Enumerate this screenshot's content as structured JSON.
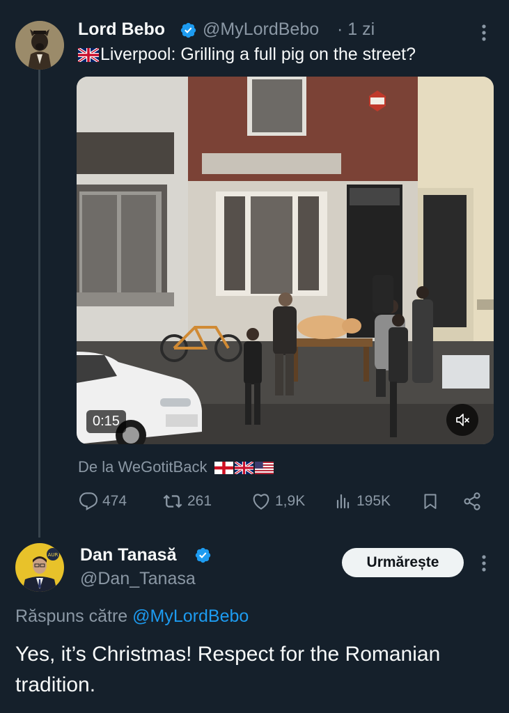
{
  "tweet": {
    "author_name": "Lord Bebo",
    "author_handle": "@MyLordBebo",
    "time_ago": "· 1 zi",
    "text": "Liverpool: Grilling a full pig on the street?",
    "flag_icon": "uk-flag-icon",
    "video_duration": "0:15",
    "source_prefix": "De la",
    "source_name": "WeGotitBack",
    "stats": {
      "replies": "474",
      "reposts": "261",
      "likes": "1,9K",
      "views": "195K"
    }
  },
  "reply": {
    "author_name": "Dan Tanasă",
    "author_handle": "@Dan_Tanasa",
    "follow_label": "Urmărește",
    "reply_to_prefix": "Răspuns către",
    "reply_to_handle": "@MyLordBebo",
    "text": "Yes, it’s Christmas! Respect for the Romanian tradition."
  },
  "colors": {
    "background": "#15202b",
    "verified": "#1d9bf0",
    "secondary_text": "#8b98a5",
    "link": "#1d9bf0"
  }
}
